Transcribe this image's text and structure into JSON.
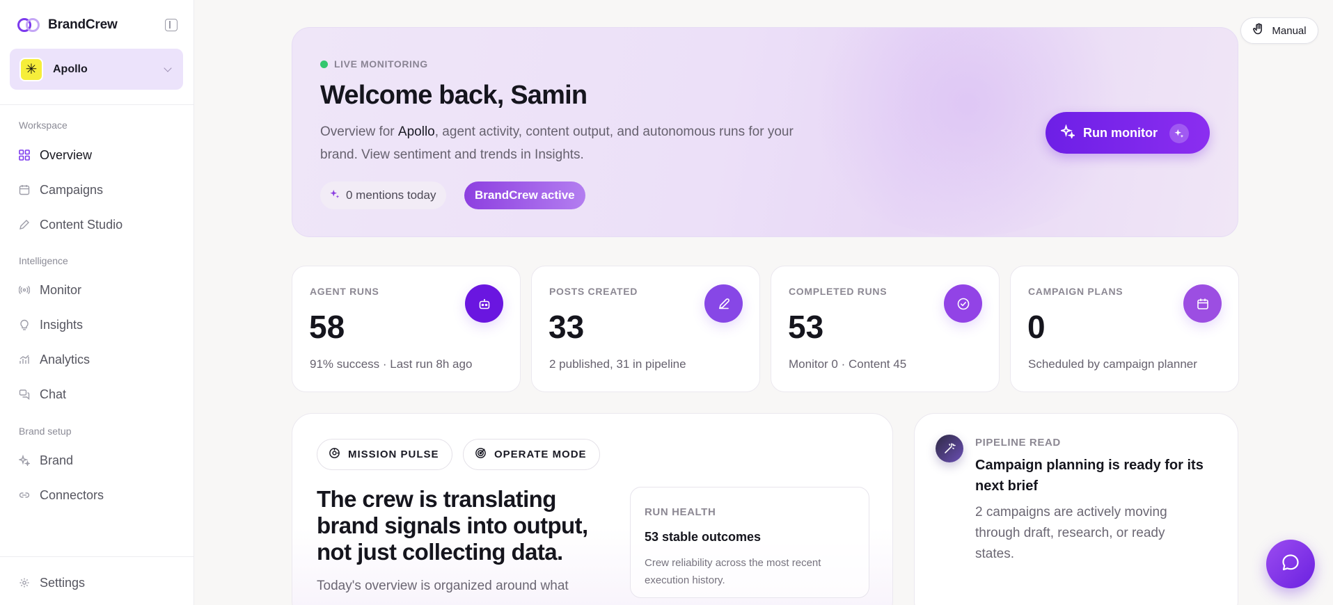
{
  "app": {
    "name": "BrandCrew",
    "workspace": "Apollo"
  },
  "sidebar": {
    "sections": [
      {
        "title": "Workspace",
        "items": [
          {
            "label": "Overview",
            "icon": "grid-icon",
            "active": true
          },
          {
            "label": "Campaigns",
            "icon": "calendar-icon"
          },
          {
            "label": "Content Studio",
            "icon": "pen-icon"
          }
        ]
      },
      {
        "title": "Intelligence",
        "items": [
          {
            "label": "Monitor",
            "icon": "radio-icon"
          },
          {
            "label": "Insights",
            "icon": "bulb-icon"
          },
          {
            "label": "Analytics",
            "icon": "chart-icon"
          },
          {
            "label": "Chat",
            "icon": "chat-icon"
          }
        ]
      },
      {
        "title": "Brand setup",
        "items": [
          {
            "label": "Brand",
            "icon": "sparkle-icon"
          },
          {
            "label": "Connectors",
            "icon": "link-icon"
          }
        ]
      }
    ],
    "settings_label": "Settings"
  },
  "topbar": {
    "manual_label": "Manual"
  },
  "hero": {
    "status": "LIVE MONITORING",
    "title": "Welcome back, Samin",
    "desc_prefix": "Overview for ",
    "desc_brand": "Apollo",
    "desc_suffix": ", agent activity, content output, and autonomous runs for your brand. View sentiment and trends in Insights.",
    "mentions": "0 mentions today",
    "active_badge": "BrandCrew active",
    "run_button": "Run monitor"
  },
  "stats": [
    {
      "label": "AGENT RUNS",
      "value": "58",
      "sub": "91% success · Last run 8h ago",
      "icon": "robot-icon",
      "color": "#6a16e0"
    },
    {
      "label": "POSTS CREATED",
      "value": "33",
      "sub": "2 published, 31 in pipeline",
      "icon": "pencil-icon",
      "color": "#8747e6"
    },
    {
      "label": "COMPLETED RUNS",
      "value": "53",
      "sub": "Monitor 0 · Content 45",
      "icon": "check-circle-icon",
      "color": "#9243e6"
    },
    {
      "label": "CAMPAIGN PLANS",
      "value": "0",
      "sub": "Scheduled by campaign planner",
      "icon": "calendar-icon",
      "color": "#9c4ee2"
    }
  ],
  "mission": {
    "chip1": "MISSION PULSE",
    "chip2": "OPERATE MODE",
    "title": "The crew is translating brand signals into output, not just collecting data.",
    "subtitle": "Today's overview is organized around what",
    "run_health": {
      "label": "RUN HEALTH",
      "value": "53 stable outcomes",
      "desc": "Crew reliability across the most recent execution history."
    }
  },
  "pipeline": {
    "label": "PIPELINE READ",
    "title": "Campaign planning is ready for its next brief",
    "desc": "2 campaigns are actively moving through draft, research, or ready states."
  },
  "colors": {
    "accent": "#7c3aed",
    "live": "#34c76f"
  }
}
